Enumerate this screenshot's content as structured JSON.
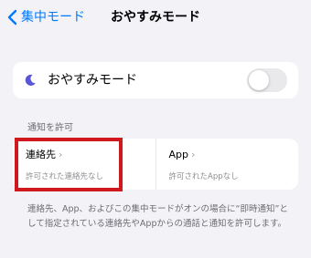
{
  "nav": {
    "back_label": "集中モード",
    "title": "おやすみモード"
  },
  "focus_toggle": {
    "label": "おやすみモード",
    "enabled": false,
    "icon": "moon-icon"
  },
  "allow_section": {
    "header": "通知を許可",
    "people": {
      "title": "連絡先",
      "subtitle": "許可された連絡先なし"
    },
    "apps": {
      "title": "App",
      "subtitle": "許可されたAppなし"
    }
  },
  "footer": {
    "text": "連絡先、App、およびこの集中モードがオンの場合に“即時通知”として指定されている連絡先やAppからの通話と通知を許可します。"
  },
  "colors": {
    "accent": "#007aff",
    "moon": "#5856d6",
    "highlight": "#d0181f",
    "background": "#f2f2f7"
  }
}
